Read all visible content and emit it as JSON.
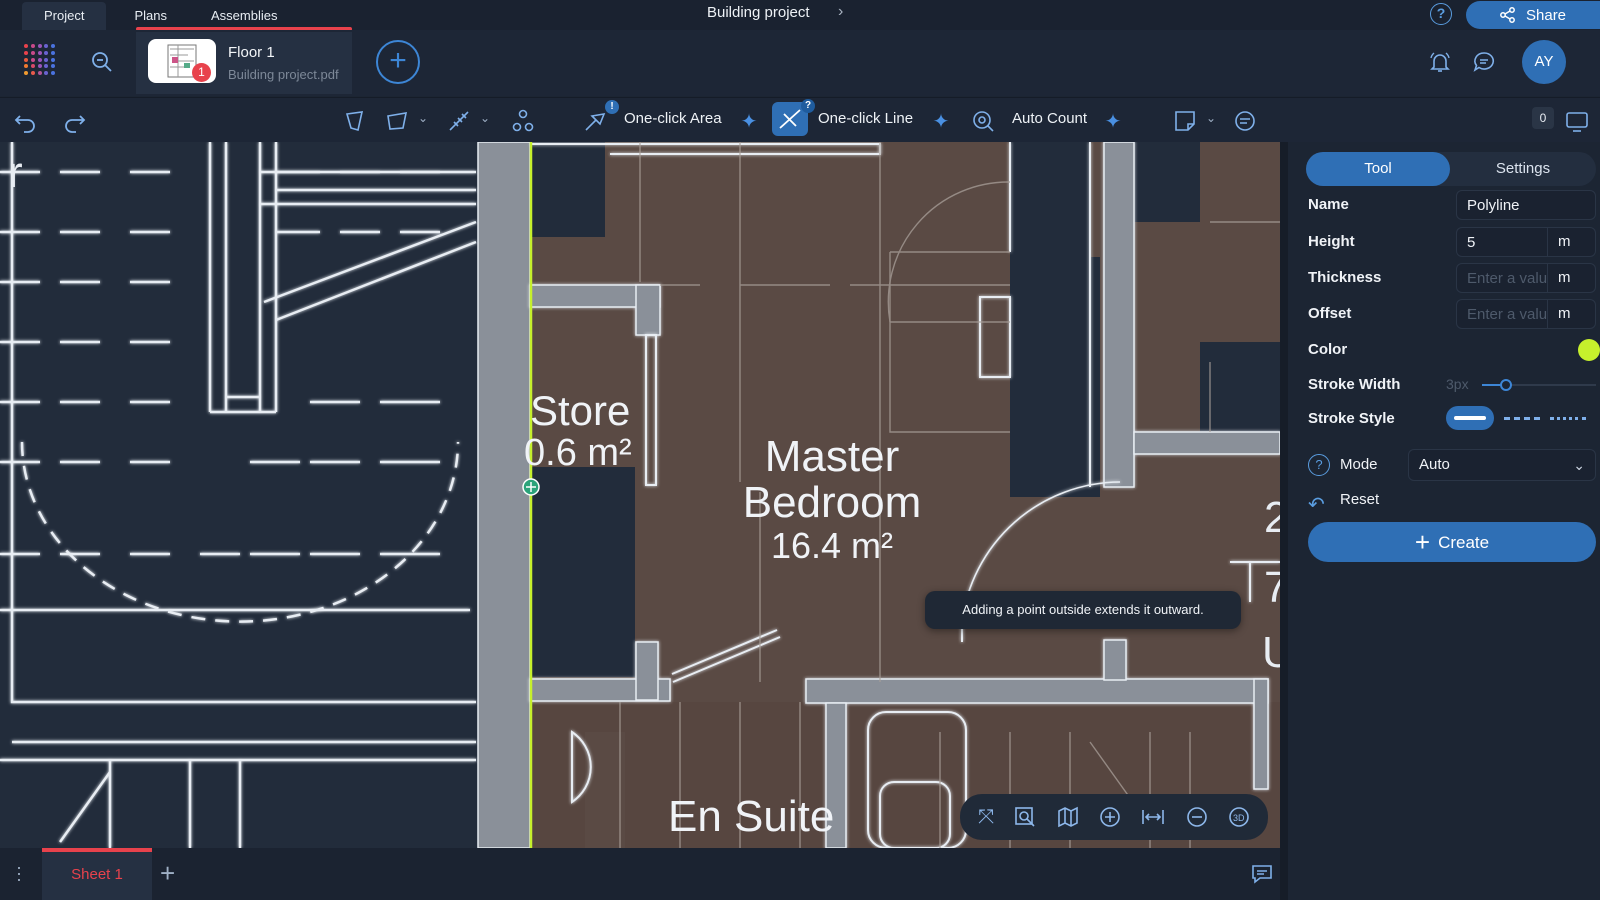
{
  "topbar": {
    "tabs": [
      "Project",
      "Plans",
      "Assemblies"
    ],
    "project_title": "Building project",
    "share_label": "Share",
    "help_label": "?"
  },
  "file": {
    "name": "Floor 1",
    "subtitle": "Building project.pdf",
    "badge": "1"
  },
  "user": {
    "initials": "AY"
  },
  "toolbar": {
    "one_click_area": "One-click Area",
    "one_click_line": "One-click Line",
    "auto_count": "Auto Count",
    "area_badge": "!",
    "line_badge": "?",
    "counter": "0"
  },
  "canvas": {
    "rooms": [
      {
        "name": "Store",
        "area": "0.6 m²"
      },
      {
        "name": "Master Bedroom",
        "area": "16.4 m²"
      },
      {
        "name": "En Suite",
        "area": ""
      }
    ],
    "tooltip": "Adding a point outside extends it outward.",
    "line_color": "#c6f02c",
    "room_fill": "#5a4a44"
  },
  "panel": {
    "tab_tool": "Tool",
    "tab_settings": "Settings",
    "name_label": "Name",
    "name_value": "Polyline",
    "height_label": "Height",
    "height_value": "5",
    "height_unit": "m",
    "thickness_label": "Thickness",
    "thickness_placeholder": "Enter a value",
    "thickness_unit": "m",
    "offset_label": "Offset",
    "offset_placeholder": "Enter a value",
    "offset_unit": "m",
    "color_label": "Color",
    "color_value": "#c6f02c",
    "stroke_width_label": "Stroke Width",
    "stroke_width_value": "3px",
    "stroke_style_label": "Stroke Style",
    "mode_label": "Mode",
    "mode_value": "Auto",
    "reset_label": "Reset",
    "create_label": "Create"
  },
  "bottombar": {
    "sheet_label": "Sheet 1"
  }
}
